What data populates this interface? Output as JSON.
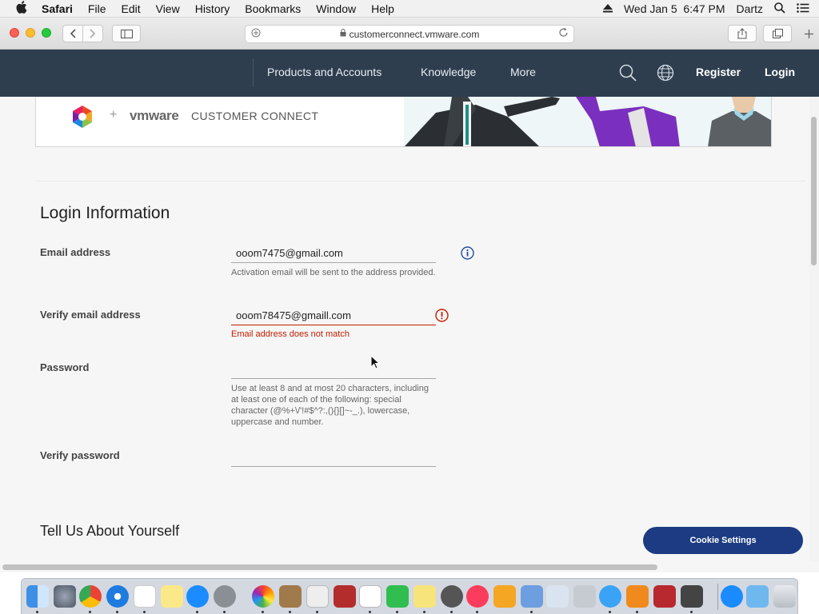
{
  "menubar": {
    "apple": "",
    "app": "Safari",
    "items": [
      "File",
      "Edit",
      "View",
      "History",
      "Bookmarks",
      "Window",
      "Help"
    ],
    "clock": "Wed Jan 5  6:47 PM",
    "user": "Dartz"
  },
  "browser": {
    "address": "customerconnect.vmware.com"
  },
  "site_nav": {
    "products": "Products and Accounts",
    "knowledge": "Knowledge",
    "more": "More",
    "register": "Register",
    "login": "Login"
  },
  "banner": {
    "plus": "+",
    "brand": "vmware",
    "product": "CUSTOMER CONNECT"
  },
  "login_section": {
    "title": "Login Information",
    "email_label": "Email address",
    "email_value": "ooom7475@gmail.com",
    "email_hint": "Activation email will be sent to the address provided.",
    "verify_email_label": "Verify email address",
    "verify_email_value": "ooom78475@gmaill.com",
    "verify_email_error": "Email address does not match",
    "password_label": "Password",
    "password_hint": "Use at least 8 and at most 20 characters, including at least one of each of the following: special character (@%+\\/'!#$^?:,(){}[]~-_.), lowercase, uppercase and number.",
    "verify_password_label": "Verify password"
  },
  "about_section": {
    "title": "Tell Us About Yourself"
  },
  "cookie_button": "Cookie Settings"
}
